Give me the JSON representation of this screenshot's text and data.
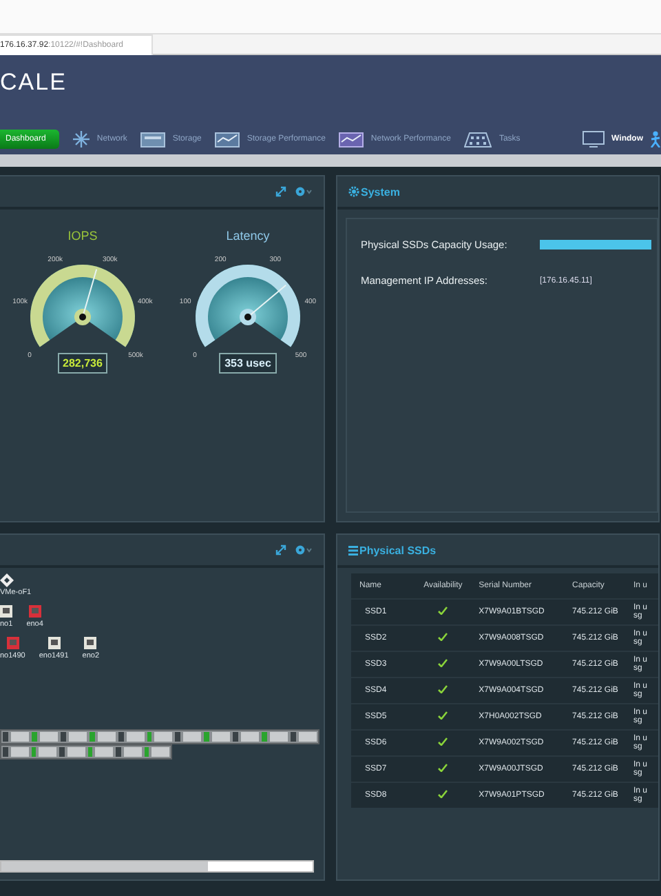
{
  "browser": {
    "address_host": "176.16.37.92",
    "address_path": ":10122/#!Dashboard"
  },
  "header": {
    "logo": "CALE",
    "nav": [
      {
        "label": "Dashboard",
        "selected": true
      },
      {
        "label": "Network",
        "selected": false
      },
      {
        "label": "Storage",
        "selected": false
      },
      {
        "label": "Storage Performance",
        "selected": false
      },
      {
        "label": "Network Performance",
        "selected": false
      },
      {
        "label": "Tasks",
        "selected": false
      },
      {
        "label": "Window",
        "selected": false
      }
    ]
  },
  "performance_panel": {
    "gauges": [
      {
        "kind": "iops",
        "title": "IOPS",
        "ticks": [
          "0",
          "100k",
          "200k",
          "300k",
          "400k",
          "500k"
        ],
        "level": 0.565,
        "reading": "282,736"
      },
      {
        "kind": "latency",
        "title": "Latency",
        "ticks": [
          "0",
          "100",
          "200",
          "300",
          "400",
          "500"
        ],
        "level": 0.7,
        "reading": "353 usec"
      }
    ]
  },
  "system_panel": {
    "title": "System",
    "rows": [
      {
        "kind": "bar",
        "label": "Physical SSDs Capacity Usage:",
        "level": 0.95
      },
      {
        "kind": "text",
        "label": "Management IP Addresses:",
        "value": "[176.16.45.11]"
      }
    ]
  },
  "network_panel": {
    "host": "VMe-oF1",
    "port_rows": [
      [
        {
          "name": "no1",
          "down": false
        },
        {
          "name": "eno4",
          "down": true
        }
      ],
      [
        {
          "name": "no1490",
          "down": true
        },
        {
          "name": "eno1491",
          "down": false
        },
        {
          "name": "eno2",
          "down": false
        }
      ]
    ]
  },
  "ssd_panel": {
    "title": "Physical SSDs",
    "columns": [
      "Name",
      "Availability",
      "Serial Number",
      "Capacity",
      "In u"
    ],
    "rows": [
      {
        "name": "SSD1",
        "available": true,
        "serial": "X7W9A01BTSGD",
        "capacity": "745.212 GiB",
        "column_5": "In u sg"
      },
      {
        "name": "SSD2",
        "available": true,
        "serial": "X7W9A008TSGD",
        "capacity": "745.212 GiB",
        "column_5": "In u sg"
      },
      {
        "name": "SSD3",
        "available": true,
        "serial": "X7W9A00LTSGD",
        "capacity": "745.212 GiB",
        "column_5": "In u sg"
      },
      {
        "name": "SSD4",
        "available": true,
        "serial": "X7W9A004TSGD",
        "capacity": "745.212 GiB",
        "column_5": "In u sg"
      },
      {
        "name": "SSD5",
        "available": true,
        "serial": "X7H0A002TSGD",
        "capacity": "745.212 GiB",
        "column_5": "In u sg"
      },
      {
        "name": "SSD6",
        "available": true,
        "serial": "X7W9A002TSGD",
        "capacity": "745.212 GiB",
        "column_5": "In u sg"
      },
      {
        "name": "SSD7",
        "available": true,
        "serial": "X7W9A00JTSGD",
        "capacity": "745.212 GiB",
        "column_5": "In u sg"
      },
      {
        "name": "SSD8",
        "available": true,
        "serial": "X7W9A01PTSGD",
        "capacity": "745.212 GiB",
        "column_5": "In u sg"
      }
    ]
  }
}
